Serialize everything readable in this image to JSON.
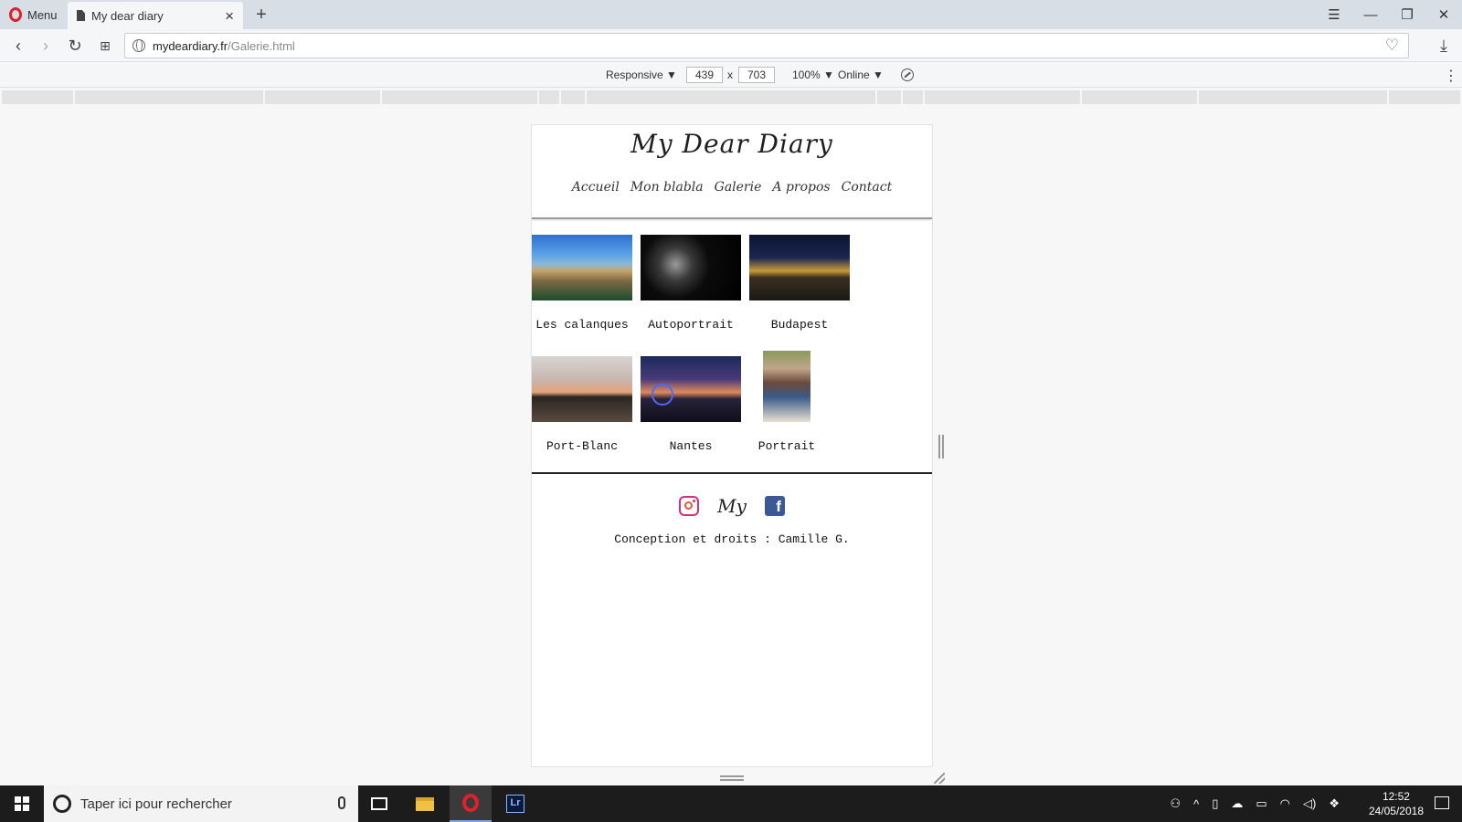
{
  "browser": {
    "menu_label": "Menu",
    "tab_title": "My dear diary",
    "url_host": "mydeardiary.fr",
    "url_path": "/Galerie.html"
  },
  "devtools": {
    "device": "Responsive ▼",
    "width": "439",
    "times": "x",
    "height": "703",
    "zoom": "100% ▼",
    "network": "Online ▼"
  },
  "site": {
    "logo": "My Dear Diary",
    "nav": [
      "Accueil",
      "Mon blabla",
      "Galerie",
      "A propos",
      "Contact"
    ],
    "gallery": [
      {
        "caption": "Les calanques"
      },
      {
        "caption": "Autoportrait"
      },
      {
        "caption": "Budapest"
      },
      {
        "caption": "Port-Blanc"
      },
      {
        "caption": "Nantes"
      },
      {
        "caption": "Portrait"
      }
    ],
    "footer": {
      "monogram": "My",
      "facebook_glyph": "f",
      "credits": "Conception et droits : Camille G."
    }
  },
  "taskbar": {
    "search_placeholder": "Taper ici pour rechercher",
    "lr_label": "Lr",
    "time": "12:52",
    "date": "24/05/2018"
  }
}
